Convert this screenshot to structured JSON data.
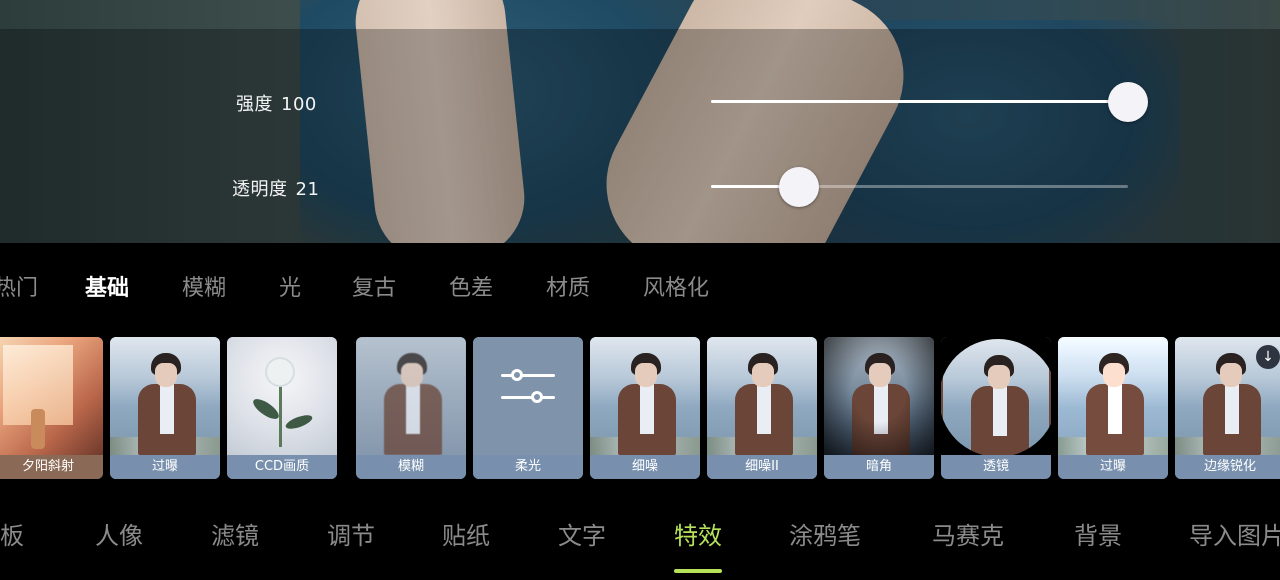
{
  "sliders": {
    "strength": {
      "label": "强度",
      "value": "100",
      "level": 1.0
    },
    "opacity": {
      "label": "透明度",
      "value": "21",
      "level": 0.21
    }
  },
  "category_tabs": [
    "热门",
    "基础",
    "模糊",
    "光",
    "复古",
    "色差",
    "材质",
    "风格化"
  ],
  "active_category": "基础",
  "effects": [
    {
      "label": "夕阳斜射",
      "scene": "sunset"
    },
    {
      "label": "过曝",
      "scene": "sea"
    },
    {
      "label": "CCD画质",
      "scene": "flower"
    },
    {
      "label": "模糊",
      "scene": "blur"
    },
    {
      "label": "柔光",
      "scene": "soft"
    },
    {
      "label": "细噪",
      "scene": "sea"
    },
    {
      "label": "细噪II",
      "scene": "sea"
    },
    {
      "label": "暗角",
      "scene": "vignette"
    },
    {
      "label": "透镜",
      "scene": "lens"
    },
    {
      "label": "过曝",
      "scene": "sea"
    },
    {
      "label": "边缘锐化",
      "scene": "sea"
    }
  ],
  "icons": {
    "soft_light": "sliders-icon",
    "download": "download-icon"
  },
  "main_tabs": [
    "模板",
    "人像",
    "滤镜",
    "调节",
    "贴纸",
    "文字",
    "特效",
    "涂鸦笔",
    "马赛克",
    "背景",
    "导入图片"
  ],
  "active_main_tab": "特效",
  "colors": {
    "accent": "#b6e35a",
    "tab_inactive": "#8b8b8b",
    "label_bg": "#7890ad"
  }
}
